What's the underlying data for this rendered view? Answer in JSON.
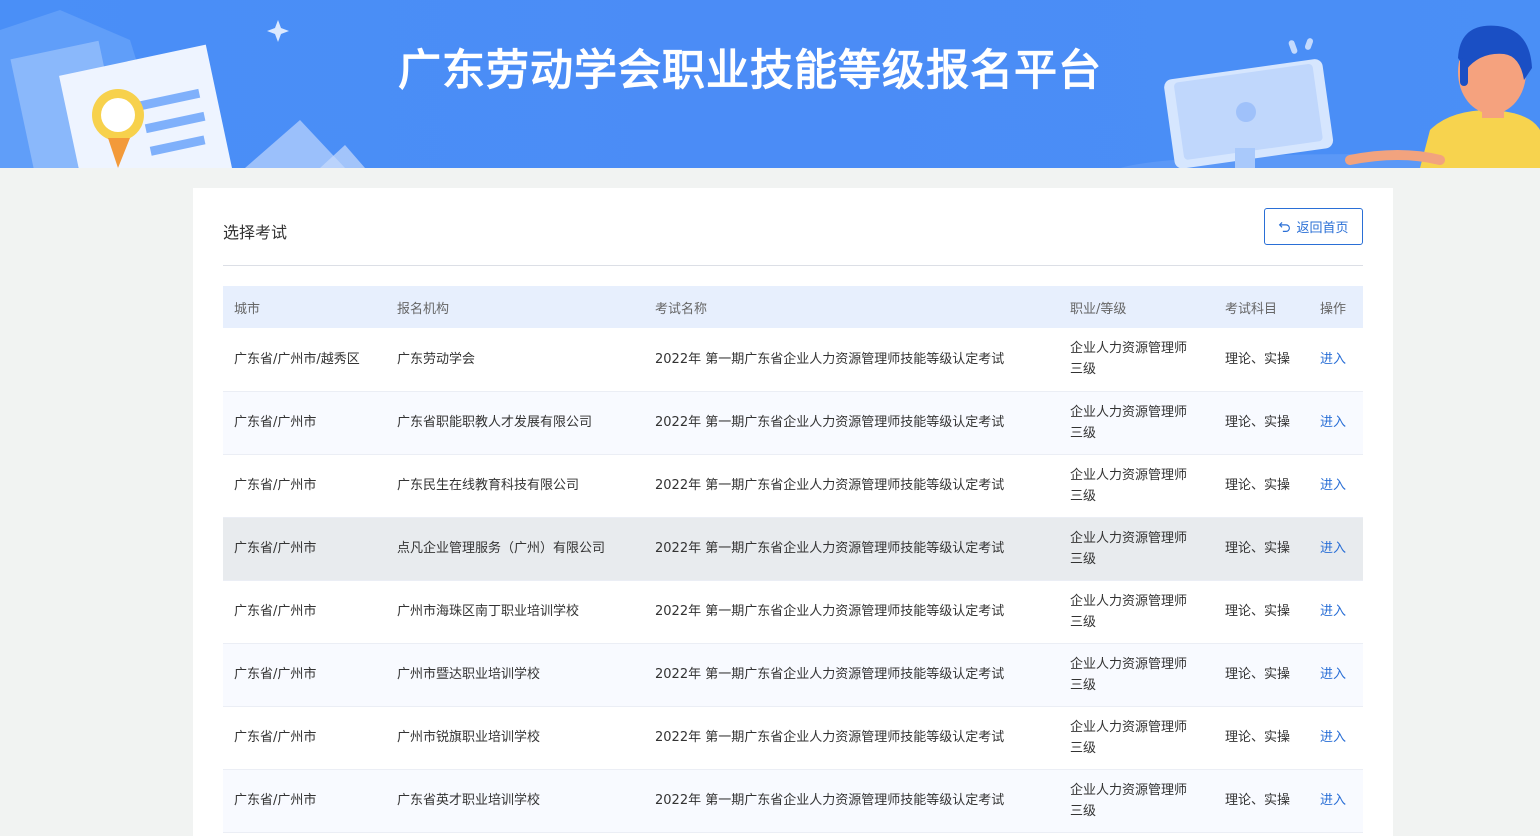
{
  "banner": {
    "title": "广东劳动学会职业技能等级报名平台"
  },
  "card": {
    "title": "选择考试",
    "back_button": "返回首页"
  },
  "table": {
    "headers": [
      "城市",
      "报名机构",
      "考试名称",
      "职业/等级",
      "考试科目",
      "操作"
    ],
    "rows": [
      {
        "city": "广东省/广州市/越秀区",
        "org": "广东劳动学会",
        "exam": "2022年 第一期广东省企业人力资源管理师技能等级认定考试",
        "job_line1": "企业人力资源管理师",
        "job_line2": "三级",
        "subjects": "理论、实操",
        "action": "进入"
      },
      {
        "city": "广东省/广州市",
        "org": "广东省职能职教人才发展有限公司",
        "exam": "2022年 第一期广东省企业人力资源管理师技能等级认定考试",
        "job_line1": "企业人力资源管理师",
        "job_line2": "三级",
        "subjects": "理论、实操",
        "action": "进入"
      },
      {
        "city": "广东省/广州市",
        "org": "广东民生在线教育科技有限公司",
        "exam": "2022年 第一期广东省企业人力资源管理师技能等级认定考试",
        "job_line1": "企业人力资源管理师",
        "job_line2": "三级",
        "subjects": "理论、实操",
        "action": "进入"
      },
      {
        "city": "广东省/广州市",
        "org": "点凡企业管理服务（广州）有限公司",
        "exam": "2022年 第一期广东省企业人力资源管理师技能等级认定考试",
        "job_line1": "企业人力资源管理师",
        "job_line2": "三级",
        "subjects": "理论、实操",
        "action": "进入"
      },
      {
        "city": "广东省/广州市",
        "org": "广州市海珠区南丁职业培训学校",
        "exam": "2022年 第一期广东省企业人力资源管理师技能等级认定考试",
        "job_line1": "企业人力资源管理师",
        "job_line2": "三级",
        "subjects": "理论、实操",
        "action": "进入"
      },
      {
        "city": "广东省/广州市",
        "org": "广州市暨达职业培训学校",
        "exam": "2022年 第一期广东省企业人力资源管理师技能等级认定考试",
        "job_line1": "企业人力资源管理师",
        "job_line2": "三级",
        "subjects": "理论、实操",
        "action": "进入"
      },
      {
        "city": "广东省/广州市",
        "org": "广州市锐旗职业培训学校",
        "exam": "2022年 第一期广东省企业人力资源管理师技能等级认定考试",
        "job_line1": "企业人力资源管理师",
        "job_line2": "三级",
        "subjects": "理论、实操",
        "action": "进入"
      },
      {
        "city": "广东省/广州市",
        "org": "广东省英才职业培训学校",
        "exam": "2022年 第一期广东省企业人力资源管理师技能等级认定考试",
        "job_line1": "企业人力资源管理师",
        "job_line2": "三级",
        "subjects": "理论、实操",
        "action": "进入"
      }
    ]
  },
  "colors": {
    "banner_blue": "#4a8ff7",
    "link_blue": "#2a6fd6",
    "header_bg": "#e7effd",
    "hover_row": "#e8ebee"
  },
  "icons": {
    "back": "undo-arrow-icon"
  }
}
